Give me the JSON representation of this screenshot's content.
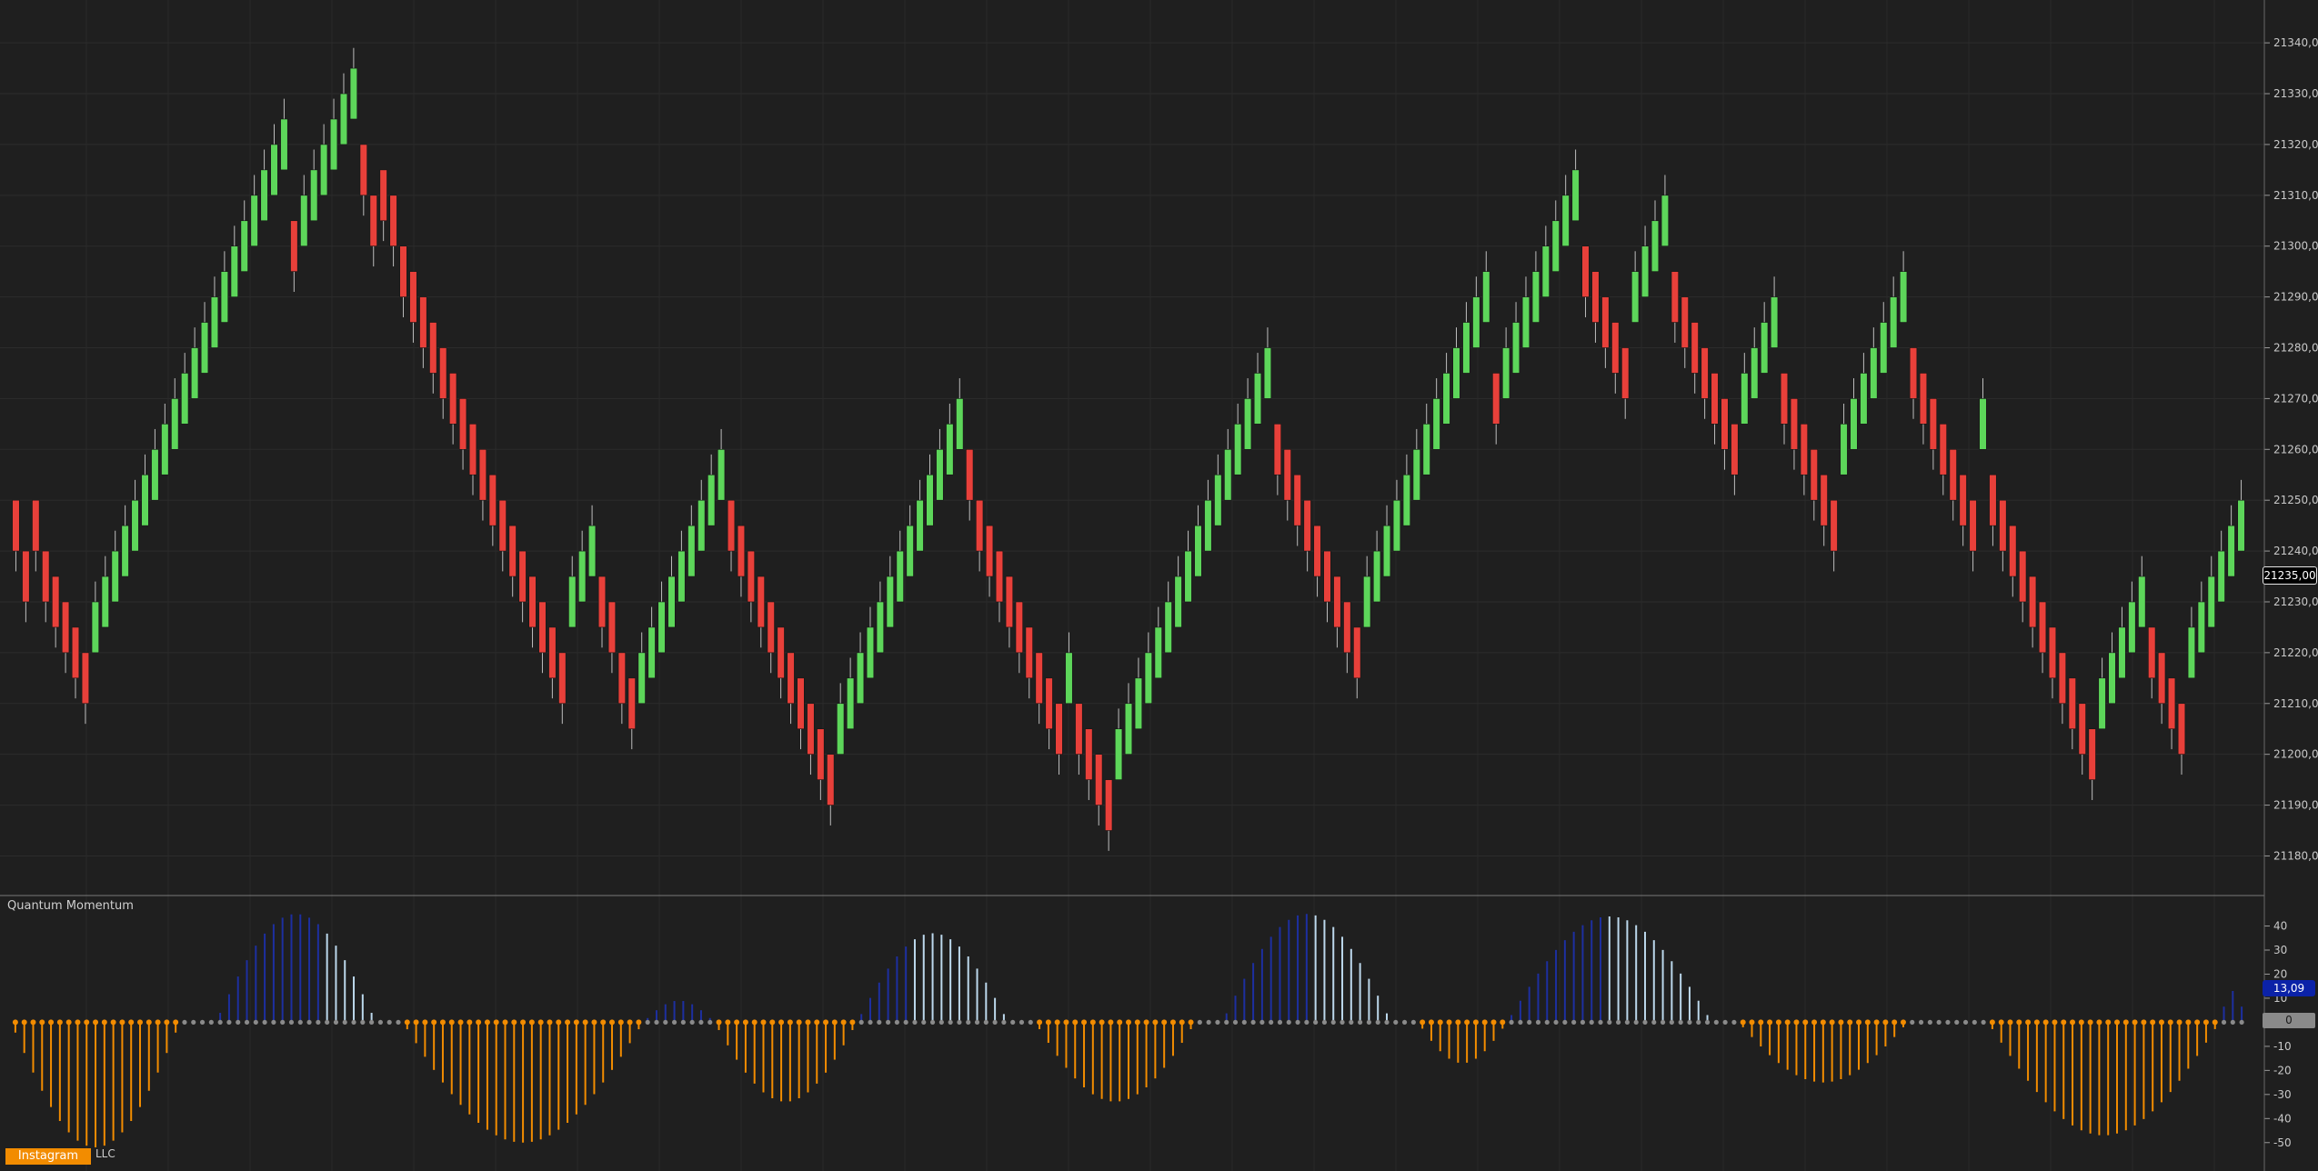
{
  "chart_data": [
    {
      "type": "candlestick",
      "panel": "price",
      "y_axis_ticks": [
        "21180,00",
        "21190,00",
        "21200,00",
        "21210,00",
        "21220,00",
        "21230,00",
        "21240,00",
        "21250,00",
        "21260,00",
        "21270,00",
        "21280,00",
        "21290,00",
        "21300,00",
        "21310,00",
        "21320,00",
        "21330,00",
        "21340,00"
      ],
      "ylim": [
        21174,
        21347
      ],
      "grid": true,
      "up_color": "#5dd65a",
      "down_color": "#e8403a",
      "last_price_label": "21235,00",
      "brick_size": 10,
      "wick_extension": 4,
      "bricks": [
        {
          "low": 21240,
          "dir": "down"
        },
        {
          "low": 21230,
          "dir": "down"
        },
        {
          "low": 21240,
          "dir": "down"
        },
        {
          "low": 21230,
          "dir": "down"
        },
        {
          "low": 21225,
          "dir": "down"
        },
        {
          "low": 21220,
          "dir": "down"
        },
        {
          "low": 21215,
          "dir": "down"
        },
        {
          "low": 21210,
          "dir": "down"
        },
        {
          "low": 21220,
          "dir": "up"
        },
        {
          "low": 21225,
          "dir": "up"
        },
        {
          "low": 21230,
          "dir": "up"
        },
        {
          "low": 21235,
          "dir": "up"
        },
        {
          "low": 21240,
          "dir": "up"
        },
        {
          "low": 21245,
          "dir": "up"
        },
        {
          "low": 21250,
          "dir": "up"
        },
        {
          "low": 21255,
          "dir": "up"
        },
        {
          "low": 21260,
          "dir": "up"
        },
        {
          "low": 21265,
          "dir": "up"
        },
        {
          "low": 21270,
          "dir": "up"
        },
        {
          "low": 21275,
          "dir": "up"
        },
        {
          "low": 21280,
          "dir": "up"
        },
        {
          "low": 21285,
          "dir": "up"
        },
        {
          "low": 21290,
          "dir": "up"
        },
        {
          "low": 21295,
          "dir": "up"
        },
        {
          "low": 21300,
          "dir": "up"
        },
        {
          "low": 21305,
          "dir": "up"
        },
        {
          "low": 21310,
          "dir": "up"
        },
        {
          "low": 21315,
          "dir": "up"
        },
        {
          "low": 21295,
          "dir": "down"
        },
        {
          "low": 21300,
          "dir": "up"
        },
        {
          "low": 21305,
          "dir": "up"
        },
        {
          "low": 21310,
          "dir": "up"
        },
        {
          "low": 21315,
          "dir": "up"
        },
        {
          "low": 21320,
          "dir": "up"
        },
        {
          "low": 21325,
          "dir": "up"
        },
        {
          "low": 21310,
          "dir": "down"
        },
        {
          "low": 21300,
          "dir": "down"
        },
        {
          "low": 21305,
          "dir": "down"
        },
        {
          "low": 21300,
          "dir": "down"
        },
        {
          "low": 21290,
          "dir": "down"
        },
        {
          "low": 21285,
          "dir": "down"
        },
        {
          "low": 21280,
          "dir": "down"
        },
        {
          "low": 21275,
          "dir": "down"
        },
        {
          "low": 21270,
          "dir": "down"
        },
        {
          "low": 21265,
          "dir": "down"
        },
        {
          "low": 21260,
          "dir": "down"
        },
        {
          "low": 21255,
          "dir": "down"
        },
        {
          "low": 21250,
          "dir": "down"
        },
        {
          "low": 21245,
          "dir": "down"
        },
        {
          "low": 21240,
          "dir": "down"
        },
        {
          "low": 21235,
          "dir": "down"
        },
        {
          "low": 21230,
          "dir": "down"
        },
        {
          "low": 21225,
          "dir": "down"
        },
        {
          "low": 21220,
          "dir": "down"
        },
        {
          "low": 21215,
          "dir": "down"
        },
        {
          "low": 21210,
          "dir": "down"
        },
        {
          "low": 21225,
          "dir": "up"
        },
        {
          "low": 21230,
          "dir": "up"
        },
        {
          "low": 21235,
          "dir": "up"
        },
        {
          "low": 21225,
          "dir": "down"
        },
        {
          "low": 21220,
          "dir": "down"
        },
        {
          "low": 21210,
          "dir": "down"
        },
        {
          "low": 21205,
          "dir": "down"
        },
        {
          "low": 21210,
          "dir": "up"
        },
        {
          "low": 21215,
          "dir": "up"
        },
        {
          "low": 21220,
          "dir": "up"
        },
        {
          "low": 21225,
          "dir": "up"
        },
        {
          "low": 21230,
          "dir": "up"
        },
        {
          "low": 21235,
          "dir": "up"
        },
        {
          "low": 21240,
          "dir": "up"
        },
        {
          "low": 21245,
          "dir": "up"
        },
        {
          "low": 21250,
          "dir": "up"
        },
        {
          "low": 21240,
          "dir": "down"
        },
        {
          "low": 21235,
          "dir": "down"
        },
        {
          "low": 21230,
          "dir": "down"
        },
        {
          "low": 21225,
          "dir": "down"
        },
        {
          "low": 21220,
          "dir": "down"
        },
        {
          "low": 21215,
          "dir": "down"
        },
        {
          "low": 21210,
          "dir": "down"
        },
        {
          "low": 21205,
          "dir": "down"
        },
        {
          "low": 21200,
          "dir": "down"
        },
        {
          "low": 21195,
          "dir": "down"
        },
        {
          "low": 21190,
          "dir": "down"
        },
        {
          "low": 21200,
          "dir": "up"
        },
        {
          "low": 21205,
          "dir": "up"
        },
        {
          "low": 21210,
          "dir": "up"
        },
        {
          "low": 21215,
          "dir": "up"
        },
        {
          "low": 21220,
          "dir": "up"
        },
        {
          "low": 21225,
          "dir": "up"
        },
        {
          "low": 21230,
          "dir": "up"
        },
        {
          "low": 21235,
          "dir": "up"
        },
        {
          "low": 21240,
          "dir": "up"
        },
        {
          "low": 21245,
          "dir": "up"
        },
        {
          "low": 21250,
          "dir": "up"
        },
        {
          "low": 21255,
          "dir": "up"
        },
        {
          "low": 21260,
          "dir": "up"
        },
        {
          "low": 21250,
          "dir": "down"
        },
        {
          "low": 21240,
          "dir": "down"
        },
        {
          "low": 21235,
          "dir": "down"
        },
        {
          "low": 21230,
          "dir": "down"
        },
        {
          "low": 21225,
          "dir": "down"
        },
        {
          "low": 21220,
          "dir": "down"
        },
        {
          "low": 21215,
          "dir": "down"
        },
        {
          "low": 21210,
          "dir": "down"
        },
        {
          "low": 21205,
          "dir": "down"
        },
        {
          "low": 21200,
          "dir": "down"
        },
        {
          "low": 21210,
          "dir": "up"
        },
        {
          "low": 21200,
          "dir": "down"
        },
        {
          "low": 21195,
          "dir": "down"
        },
        {
          "low": 21190,
          "dir": "down"
        },
        {
          "low": 21185,
          "dir": "down"
        },
        {
          "low": 21195,
          "dir": "up"
        },
        {
          "low": 21200,
          "dir": "up"
        },
        {
          "low": 21205,
          "dir": "up"
        },
        {
          "low": 21210,
          "dir": "up"
        },
        {
          "low": 21215,
          "dir": "up"
        },
        {
          "low": 21220,
          "dir": "up"
        },
        {
          "low": 21225,
          "dir": "up"
        },
        {
          "low": 21230,
          "dir": "up"
        },
        {
          "low": 21235,
          "dir": "up"
        },
        {
          "low": 21240,
          "dir": "up"
        },
        {
          "low": 21245,
          "dir": "up"
        },
        {
          "low": 21250,
          "dir": "up"
        },
        {
          "low": 21255,
          "dir": "up"
        },
        {
          "low": 21260,
          "dir": "up"
        },
        {
          "low": 21265,
          "dir": "up"
        },
        {
          "low": 21270,
          "dir": "up"
        },
        {
          "low": 21255,
          "dir": "down"
        },
        {
          "low": 21250,
          "dir": "down"
        },
        {
          "low": 21245,
          "dir": "down"
        },
        {
          "low": 21240,
          "dir": "down"
        },
        {
          "low": 21235,
          "dir": "down"
        },
        {
          "low": 21230,
          "dir": "down"
        },
        {
          "low": 21225,
          "dir": "down"
        },
        {
          "low": 21220,
          "dir": "down"
        },
        {
          "low": 21215,
          "dir": "down"
        },
        {
          "low": 21225,
          "dir": "up"
        },
        {
          "low": 21230,
          "dir": "up"
        },
        {
          "low": 21235,
          "dir": "up"
        },
        {
          "low": 21240,
          "dir": "up"
        },
        {
          "low": 21245,
          "dir": "up"
        },
        {
          "low": 21250,
          "dir": "up"
        },
        {
          "low": 21255,
          "dir": "up"
        },
        {
          "low": 21260,
          "dir": "up"
        },
        {
          "low": 21265,
          "dir": "up"
        },
        {
          "low": 21270,
          "dir": "up"
        },
        {
          "low": 21275,
          "dir": "up"
        },
        {
          "low": 21280,
          "dir": "up"
        },
        {
          "low": 21285,
          "dir": "up"
        },
        {
          "low": 21265,
          "dir": "down"
        },
        {
          "low": 21270,
          "dir": "up"
        },
        {
          "low": 21275,
          "dir": "up"
        },
        {
          "low": 21280,
          "dir": "up"
        },
        {
          "low": 21285,
          "dir": "up"
        },
        {
          "low": 21290,
          "dir": "up"
        },
        {
          "low": 21295,
          "dir": "up"
        },
        {
          "low": 21300,
          "dir": "up"
        },
        {
          "low": 21305,
          "dir": "up"
        },
        {
          "low": 21290,
          "dir": "down"
        },
        {
          "low": 21285,
          "dir": "down"
        },
        {
          "low": 21280,
          "dir": "down"
        },
        {
          "low": 21275,
          "dir": "down"
        },
        {
          "low": 21270,
          "dir": "down"
        },
        {
          "low": 21285,
          "dir": "up"
        },
        {
          "low": 21290,
          "dir": "up"
        },
        {
          "low": 21295,
          "dir": "up"
        },
        {
          "low": 21300,
          "dir": "up"
        },
        {
          "low": 21285,
          "dir": "down"
        },
        {
          "low": 21280,
          "dir": "down"
        },
        {
          "low": 21275,
          "dir": "down"
        },
        {
          "low": 21270,
          "dir": "down"
        },
        {
          "low": 21265,
          "dir": "down"
        },
        {
          "low": 21260,
          "dir": "down"
        },
        {
          "low": 21255,
          "dir": "down"
        },
        {
          "low": 21265,
          "dir": "up"
        },
        {
          "low": 21270,
          "dir": "up"
        },
        {
          "low": 21275,
          "dir": "up"
        },
        {
          "low": 21280,
          "dir": "up"
        },
        {
          "low": 21265,
          "dir": "down"
        },
        {
          "low": 21260,
          "dir": "down"
        },
        {
          "low": 21255,
          "dir": "down"
        },
        {
          "low": 21250,
          "dir": "down"
        },
        {
          "low": 21245,
          "dir": "down"
        },
        {
          "low": 21240,
          "dir": "down"
        },
        {
          "low": 21255,
          "dir": "up"
        },
        {
          "low": 21260,
          "dir": "up"
        },
        {
          "low": 21265,
          "dir": "up"
        },
        {
          "low": 21270,
          "dir": "up"
        },
        {
          "low": 21275,
          "dir": "up"
        },
        {
          "low": 21280,
          "dir": "up"
        },
        {
          "low": 21285,
          "dir": "up"
        },
        {
          "low": 21270,
          "dir": "down"
        },
        {
          "low": 21265,
          "dir": "down"
        },
        {
          "low": 21260,
          "dir": "down"
        },
        {
          "low": 21255,
          "dir": "down"
        },
        {
          "low": 21250,
          "dir": "down"
        },
        {
          "low": 21245,
          "dir": "down"
        },
        {
          "low": 21240,
          "dir": "down"
        },
        {
          "low": 21260,
          "dir": "up"
        },
        {
          "low": 21245,
          "dir": "down"
        },
        {
          "low": 21240,
          "dir": "down"
        },
        {
          "low": 21235,
          "dir": "down"
        },
        {
          "low": 21230,
          "dir": "down"
        },
        {
          "low": 21225,
          "dir": "down"
        },
        {
          "low": 21220,
          "dir": "down"
        },
        {
          "low": 21215,
          "dir": "down"
        },
        {
          "low": 21210,
          "dir": "down"
        },
        {
          "low": 21205,
          "dir": "down"
        },
        {
          "low": 21200,
          "dir": "down"
        },
        {
          "low": 21195,
          "dir": "down"
        },
        {
          "low": 21205,
          "dir": "up"
        },
        {
          "low": 21210,
          "dir": "up"
        },
        {
          "low": 21215,
          "dir": "up"
        },
        {
          "low": 21220,
          "dir": "up"
        },
        {
          "low": 21225,
          "dir": "up"
        },
        {
          "low": 21215,
          "dir": "down"
        },
        {
          "low": 21210,
          "dir": "down"
        },
        {
          "low": 21205,
          "dir": "down"
        },
        {
          "low": 21200,
          "dir": "down"
        },
        {
          "low": 21215,
          "dir": "up"
        },
        {
          "low": 21220,
          "dir": "up"
        },
        {
          "low": 21225,
          "dir": "up"
        },
        {
          "low": 21230,
          "dir": "up"
        },
        {
          "low": 21235,
          "dir": "up"
        },
        {
          "low": 21240,
          "dir": "up"
        }
      ]
    },
    {
      "type": "histogram",
      "panel": "indicator",
      "title": "Quantum Momentum",
      "y_axis_ticks": [
        "40",
        "30",
        "20",
        "10",
        "0",
        "-10",
        "-20",
        "-30",
        "-40",
        "-50"
      ],
      "ylim": [
        -55,
        47
      ],
      "last_value_label": "13,09",
      "zero_label": "0",
      "colors": {
        "pos_strong": "#1d2fa0",
        "pos_fade": "#bcd8ec",
        "neg_strong": "#f28c00",
        "dot_neg": "#f28c00",
        "dot_flat": "#8a8a8a"
      },
      "segments": [
        {
          "kind": "neg",
          "len": 19,
          "peak": -52
        },
        {
          "kind": "flat",
          "len": 4
        },
        {
          "kind": "pos",
          "len": 18,
          "peak": 45,
          "fade_after": 12
        },
        {
          "kind": "flat",
          "len": 3
        },
        {
          "kind": "neg",
          "len": 27,
          "peak": -50
        },
        {
          "kind": "pos",
          "len": 8,
          "peak": 9
        },
        {
          "kind": "neg",
          "len": 16,
          "peak": -33
        },
        {
          "kind": "pos",
          "len": 17,
          "peak": 37,
          "fade_after": 6
        },
        {
          "kind": "flat",
          "len": 3
        },
        {
          "kind": "neg",
          "len": 18,
          "peak": -33
        },
        {
          "kind": "flat",
          "len": 3
        },
        {
          "kind": "pos",
          "len": 19,
          "peak": 45,
          "fade_after": 10
        },
        {
          "kind": "flat",
          "len": 3
        },
        {
          "kind": "neg",
          "len": 10,
          "peak": -17
        },
        {
          "kind": "pos",
          "len": 23,
          "peak": 44,
          "fade_after": 11
        },
        {
          "kind": "flat",
          "len": 3
        },
        {
          "kind": "neg",
          "len": 19,
          "peak": -25
        },
        {
          "kind": "flat",
          "len": 9
        },
        {
          "kind": "neg",
          "len": 26,
          "peak": -47
        },
        {
          "kind": "pos",
          "len": 3,
          "peak": 13
        }
      ]
    }
  ],
  "footer": {
    "badge": "Instagram",
    "suffix": "LLC"
  }
}
